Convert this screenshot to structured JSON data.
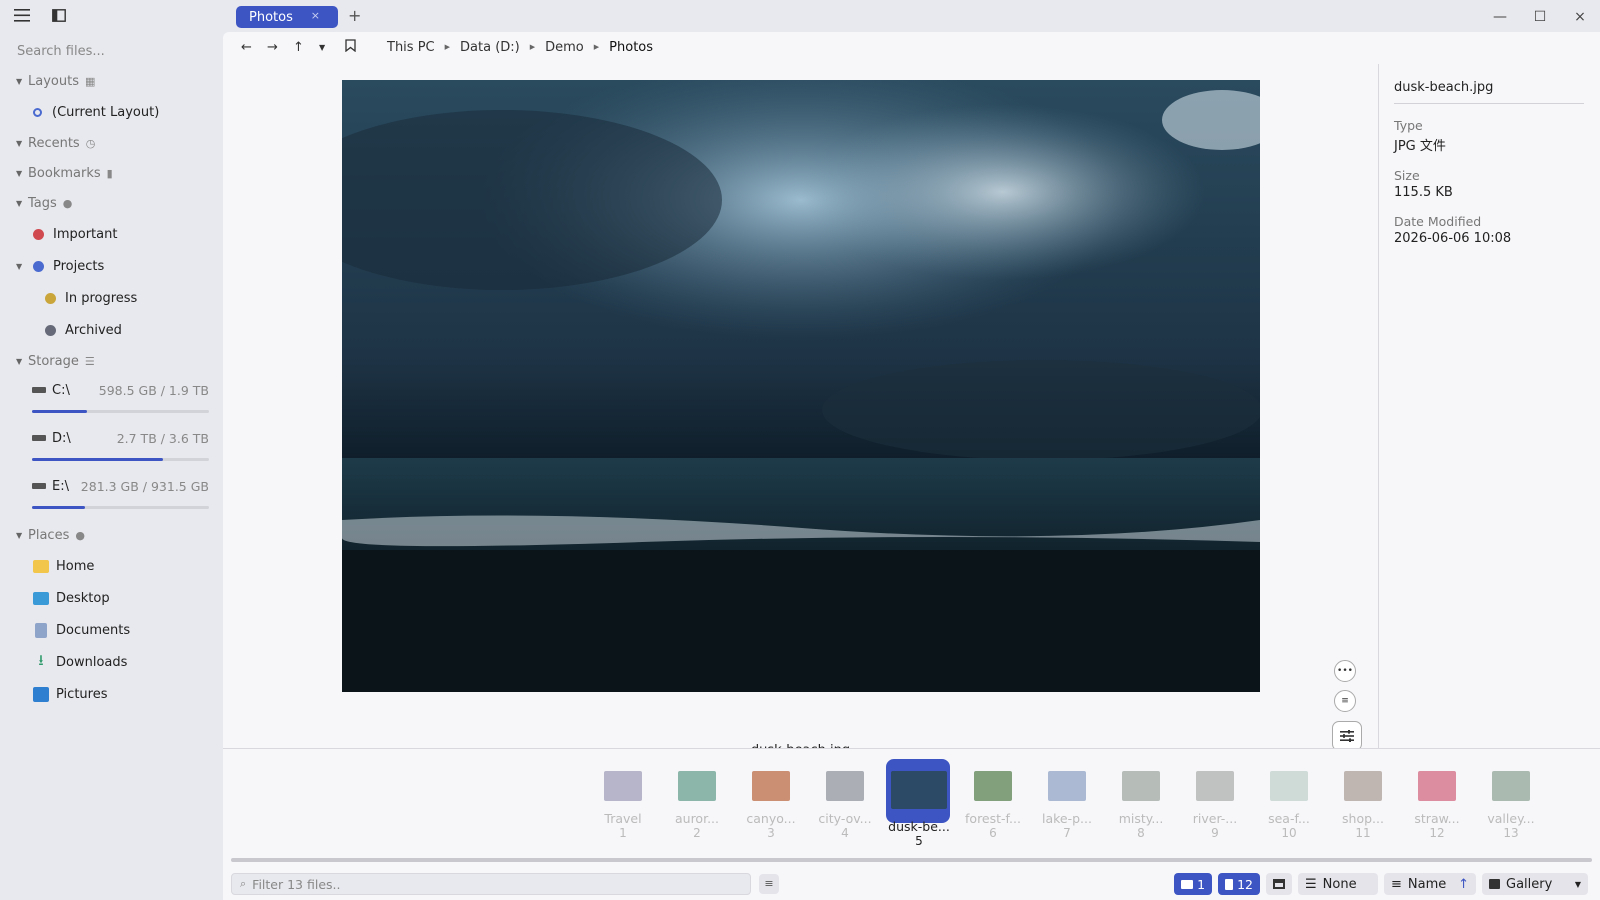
{
  "sidebar": {
    "search_placeholder": "Search files...",
    "sections": {
      "layouts": "Layouts",
      "current_layout": "(Current Layout)",
      "recents": "Recents",
      "bookmarks": "Bookmarks",
      "tags": "Tags",
      "storage": "Storage",
      "places": "Places"
    },
    "tags": [
      {
        "label": "Important",
        "color": "#d0494f"
      },
      {
        "label": "Projects",
        "color": "#4a6ad0"
      },
      {
        "label": "In progress",
        "color": "#c9a53a"
      },
      {
        "label": "Archived",
        "color": "#666a78"
      }
    ],
    "drives": [
      {
        "label": "C:\\",
        "capacity": "598.5 GB / 1.9 TB",
        "fill": 0.31
      },
      {
        "label": "D:\\",
        "capacity": "2.7 TB / 3.6 TB",
        "fill": 0.74
      },
      {
        "label": "E:\\",
        "capacity": "281.3 GB / 931.5 GB",
        "fill": 0.3
      }
    ],
    "places": [
      {
        "label": "Home",
        "icon": "folder-icon",
        "color": "#f2c64a"
      },
      {
        "label": "Desktop",
        "icon": "desktop-icon",
        "color": "#3a9ad8"
      },
      {
        "label": "Documents",
        "icon": "documents-icon",
        "color": "#8fa4c9"
      },
      {
        "label": "Downloads",
        "icon": "download-icon",
        "color": "#2f9a6b"
      },
      {
        "label": "Pictures",
        "icon": "pictures-icon",
        "color": "#2e7fd0"
      }
    ]
  },
  "tab": {
    "label": "Photos",
    "close": "×",
    "new": "+"
  },
  "window": {
    "minimize": "—",
    "maximize": "☐",
    "close": "×"
  },
  "breadcrumbs": [
    "This PC",
    "Data (D:)",
    "Demo",
    "Photos"
  ],
  "viewer": {
    "caption": "dusk-beach.jpg"
  },
  "info": {
    "filename": "dusk-beach.jpg",
    "type_label": "Type",
    "type_value": "JPG 文件",
    "size_label": "Size",
    "size_value": "115.5 KB",
    "date_label": "Date Modified",
    "date_value": "2026-06-06 10:08"
  },
  "thumbnails": [
    {
      "name": "Travel",
      "num": "1",
      "color": "#9a98b4"
    },
    {
      "name": "auror...",
      "num": "2",
      "color": "#5e9a86"
    },
    {
      "name": "canyo...",
      "num": "3",
      "color": "#b8643a"
    },
    {
      "name": "city-ov...",
      "num": "4",
      "color": "#8a8f96"
    },
    {
      "name": "dusk-be...",
      "num": "5",
      "color": "#2c4a66",
      "selected": true
    },
    {
      "name": "forest-f...",
      "num": "6",
      "color": "#4f7a44"
    },
    {
      "name": "lake-p...",
      "num": "7",
      "color": "#8aa0c0"
    },
    {
      "name": "misty...",
      "num": "8",
      "color": "#9aa39a"
    },
    {
      "name": "river-...",
      "num": "9",
      "color": "#a8aaa8"
    },
    {
      "name": "sea-f...",
      "num": "10",
      "color": "#bccfc8"
    },
    {
      "name": "shop...",
      "num": "11",
      "color": "#a89a92"
    },
    {
      "name": "straw...",
      "num": "12",
      "color": "#d06078"
    },
    {
      "name": "valley...",
      "num": "13",
      "color": "#8aa090"
    }
  ],
  "status": {
    "filter_placeholder": "Filter 13 files..",
    "folders_count": "1",
    "files_count": "12",
    "group": "None",
    "sort": "Name",
    "view": "Gallery"
  },
  "colors": {
    "accent": "#3d55c3"
  }
}
